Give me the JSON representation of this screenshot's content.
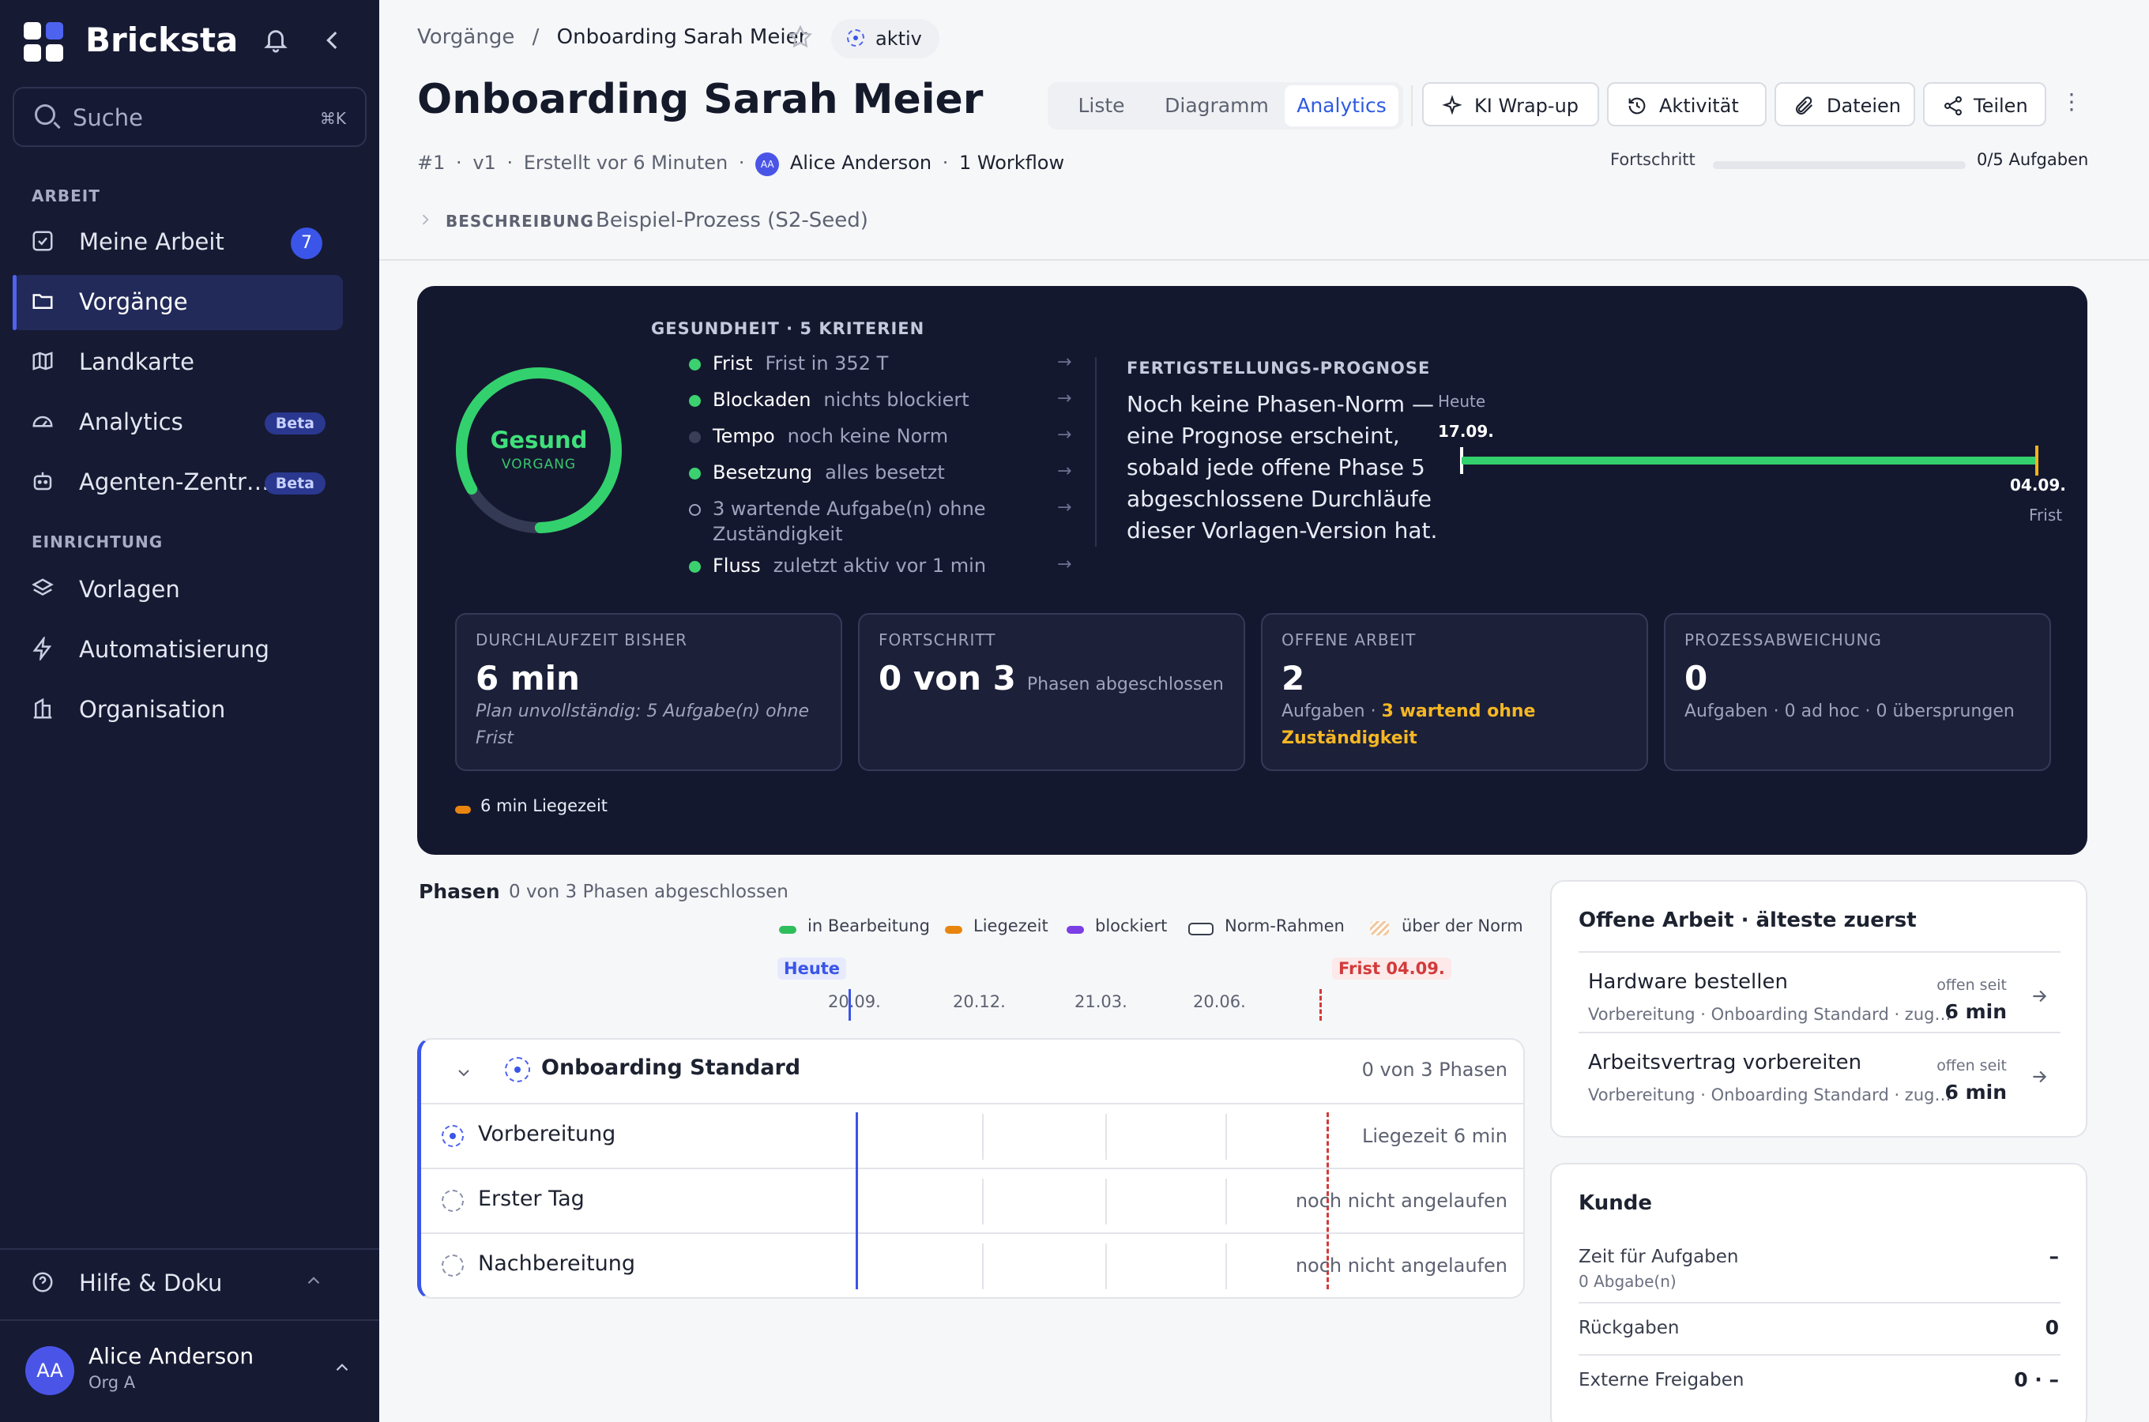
{
  "app": {
    "brand": "Bricksta"
  },
  "sidebar": {
    "search_placeholder": "Suche",
    "search_shortcut": "⌘K",
    "section_work": "ARBEIT",
    "section_setup": "EINRICHTUNG",
    "items": [
      {
        "label": "Meine Arbeit",
        "badge": "7"
      },
      {
        "label": "Vorgänge"
      },
      {
        "label": "Landkarte"
      },
      {
        "label": "Analytics",
        "badge": "Beta"
      },
      {
        "label": "Agenten-Zentr…",
        "badge": "Beta"
      },
      {
        "label": "Vorlagen"
      },
      {
        "label": "Automatisierung"
      },
      {
        "label": "Organisation"
      }
    ],
    "help": "Hilfe & Doku",
    "user": {
      "initials": "AA",
      "name": "Alice Anderson",
      "org": "Org A"
    }
  },
  "header": {
    "breadcrumb_root": "Vorgänge",
    "breadcrumb_sep": "/",
    "breadcrumb_current": "Onboarding Sarah Meier",
    "status": "aktiv",
    "title": "Onboarding Sarah Meier",
    "tabs": [
      "Liste",
      "Diagramm",
      "Analytics"
    ],
    "actions": [
      "KI Wrap-up",
      "Aktivität",
      "Dateien",
      "Teilen"
    ],
    "more": "⋮",
    "meta": {
      "id": "#1",
      "version": "v1",
      "created": "Erstellt vor 6 Minuten",
      "owner_initials": "AA",
      "owner": "Alice Anderson",
      "workflows": "1 Workflow",
      "sep": "·"
    },
    "progress_label": "Fortschritt",
    "progress_value": 0,
    "progress_text": "0/5 Aufgaben",
    "description_label": "BESCHREIBUNG",
    "description": "Beispiel-Prozess (S2-Seed)"
  },
  "health": {
    "ring_label": "Gesund",
    "ring_sub": "VORGANG",
    "ring_fraction": 0.83,
    "title": "GESUNDHEIT · 5 KRITERIEN",
    "criteria": [
      {
        "name": "Frist",
        "desc": "Frist in 352 T",
        "color": "#3bd16f"
      },
      {
        "name": "Blockaden",
        "desc": "nichts blockiert",
        "color": "#3bd16f"
      },
      {
        "name": "Tempo",
        "desc": "noch keine Norm",
        "color": "#3a3f57"
      },
      {
        "name": "Besetzung",
        "desc": "alles besetzt",
        "color": "#3bd16f"
      },
      {
        "name": "",
        "desc": "3 wartende Aufgabe(n) ohne",
        "desc2": "Zuständigkeit",
        "color": "hollow"
      },
      {
        "name": "Fluss",
        "desc": "zuletzt aktiv vor 1 min",
        "color": "#3bd16f"
      }
    ],
    "arrow": "→",
    "forecast_title": "FERTIGSTELLUNGS-PROGNOSE",
    "forecast_lines": [
      "Noch keine Phasen-Norm —",
      "eine Prognose erscheint,",
      "sobald jede offene Phase 5",
      "abgeschlossene Durchläufe",
      "dieser Vorlagen-Version hat."
    ],
    "today_label": "Heute",
    "today_date": "17.09.",
    "deadline_date": "04.09.",
    "deadline_label": "Frist"
  },
  "cards": [
    {
      "title": "DURCHLAUFZEIT BISHER",
      "value": "6 min",
      "sub1": "Plan unvollständig: 5 Aufgabe(n) ohne",
      "sub2": "Frist"
    },
    {
      "title": "FORTSCHRITT",
      "value": "0 von 3",
      "inline": "Phasen abgeschlossen"
    },
    {
      "title": "OFFENE ARBEIT",
      "value": "2",
      "sub_a": "Aufgaben · ",
      "sub_b": "3 wartend ohne",
      "sub_c": "Zuständigkeit"
    },
    {
      "title": "PROZESSABWEICHUNG",
      "value": "0",
      "sub1": "Aufgaben · 0 ad hoc · 0 übersprungen"
    }
  ],
  "idle": "6 min Liegezeit",
  "phases": {
    "title": "Phasen",
    "summary": "0 von 3 Phasen abgeschlossen",
    "legend": [
      "in Bearbeitung",
      "Liegezeit",
      "blockiert",
      "Norm-Rahmen",
      "über der Norm"
    ],
    "today_label": "Heute",
    "deadline_label": "Frist 04.09.",
    "ticks": [
      "20.09.",
      "20.12.",
      "21.03.",
      "20.06."
    ],
    "group_name": "Onboarding Standard",
    "group_count": "0 von 3 Phasen",
    "rows": [
      {
        "name": "Vorbereitung",
        "status": "Liegezeit 6 min"
      },
      {
        "name": "Erster Tag",
        "status": "noch nicht angelaufen"
      },
      {
        "name": "Nachbereitung",
        "status": "noch nicht angelaufen"
      }
    ]
  },
  "open_work": {
    "title": "Offene Arbeit · älteste zuerst",
    "items": [
      {
        "name": "Hardware bestellen",
        "sub": "Vorbereitung · Onboarding Standard · zug…",
        "since": "offen seit",
        "age": "6 min"
      },
      {
        "name": "Arbeitsvertrag vorbereiten",
        "sub": "Vorbereitung · Onboarding Standard · zug…",
        "since": "offen seit",
        "age": "6 min"
      }
    ]
  },
  "customer": {
    "title": "Kunde",
    "rows": [
      {
        "label": "Zeit für Aufgaben",
        "sub": "0 Abgabe(n)",
        "value": "–"
      },
      {
        "label": "Rückgaben",
        "value": "0"
      },
      {
        "label": "Externe Freigaben",
        "value": "0 · –"
      }
    ]
  }
}
